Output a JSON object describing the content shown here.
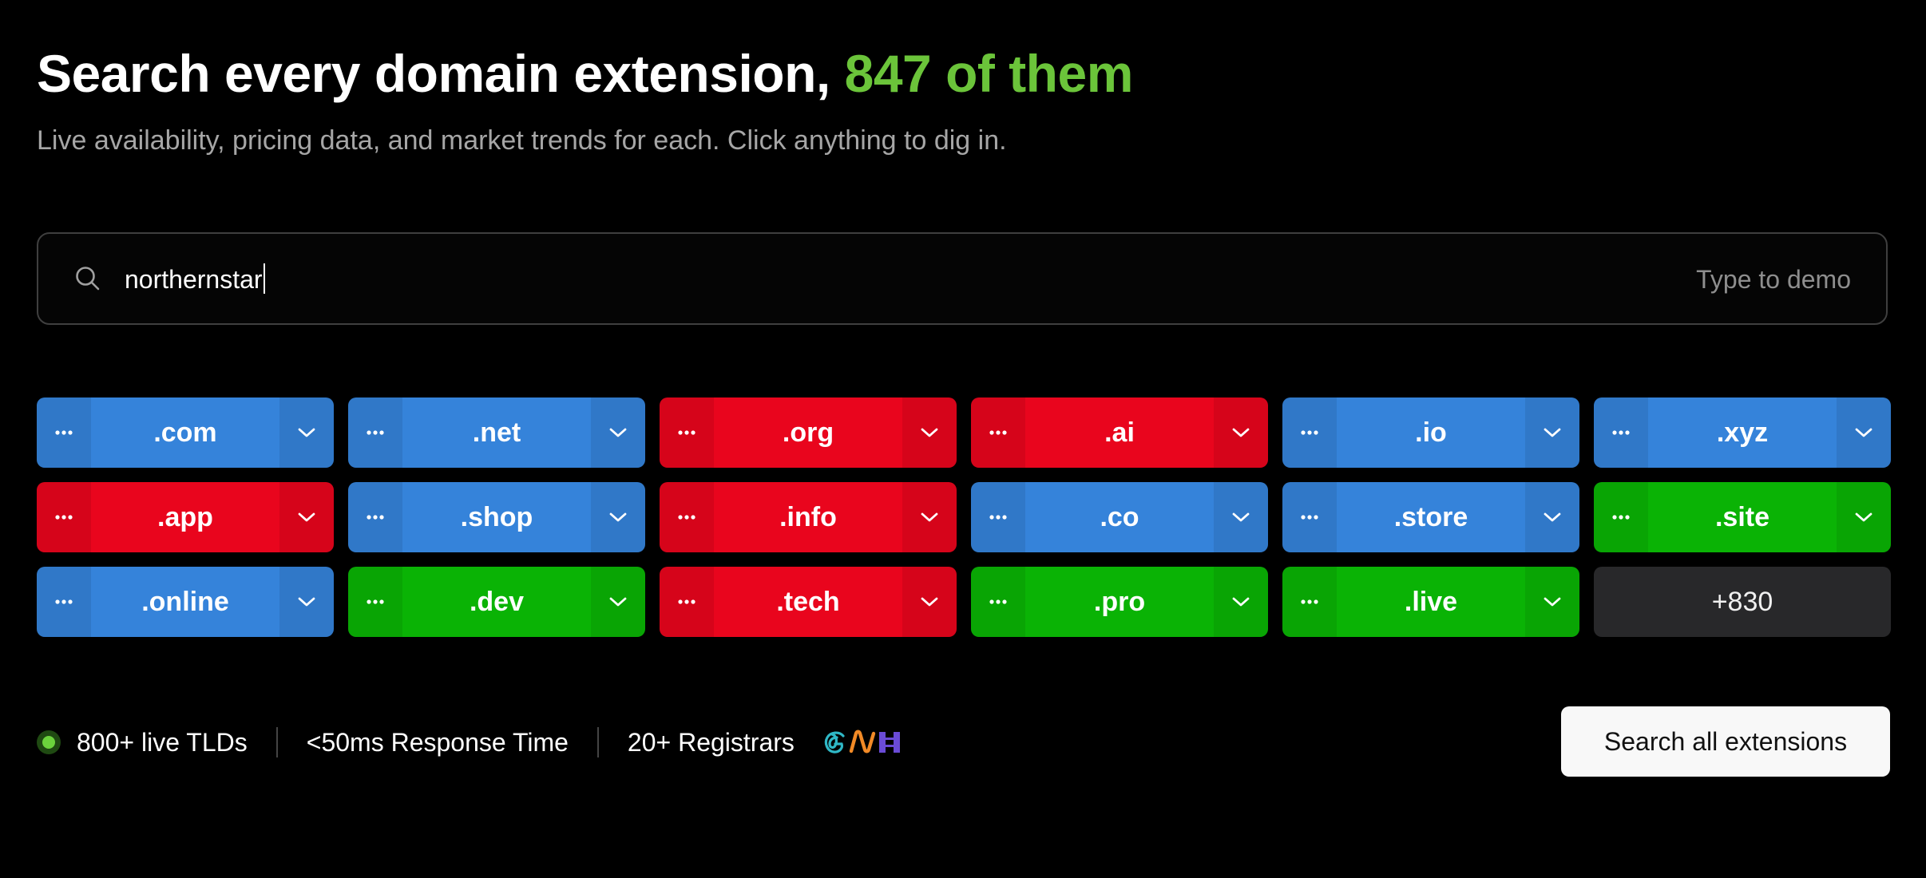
{
  "header": {
    "title": "Search every domain extension,",
    "title_accent": "847 of them",
    "subtitle": "Live availability, pricing data, and market trends for each. Click anything to dig in.",
    "accent_color": "#6bc43a"
  },
  "search": {
    "icon": "search-icon",
    "value": "northernstar",
    "hint": "Type to demo"
  },
  "tld_grid": {
    "colors": {
      "blue": "#3583da",
      "red": "#e9051d",
      "green": "#0ab305",
      "more": "#28282a"
    },
    "items": [
      {
        "label": ".com",
        "color": "blue"
      },
      {
        "label": ".net",
        "color": "blue"
      },
      {
        "label": ".org",
        "color": "red"
      },
      {
        "label": ".ai",
        "color": "red"
      },
      {
        "label": ".io",
        "color": "blue"
      },
      {
        "label": ".xyz",
        "color": "blue"
      },
      {
        "label": ".app",
        "color": "red"
      },
      {
        "label": ".shop",
        "color": "blue"
      },
      {
        "label": ".info",
        "color": "red"
      },
      {
        "label": ".co",
        "color": "blue"
      },
      {
        "label": ".store",
        "color": "blue"
      },
      {
        "label": ".site",
        "color": "green"
      },
      {
        "label": ".online",
        "color": "blue"
      },
      {
        "label": ".dev",
        "color": "green"
      },
      {
        "label": ".tech",
        "color": "red"
      },
      {
        "label": ".pro",
        "color": "green"
      },
      {
        "label": ".live",
        "color": "green"
      }
    ],
    "more_label": "+830"
  },
  "stats": {
    "live_tlds": "800+ live TLDs",
    "response_time": "<50ms Response Time",
    "registrars": "20+ Registrars",
    "status_color": "#6bd33c",
    "registrar_logos": [
      "godaddy-logo",
      "namecheap-logo",
      "porkbun-logo"
    ]
  },
  "cta": {
    "label": "Search all extensions"
  }
}
